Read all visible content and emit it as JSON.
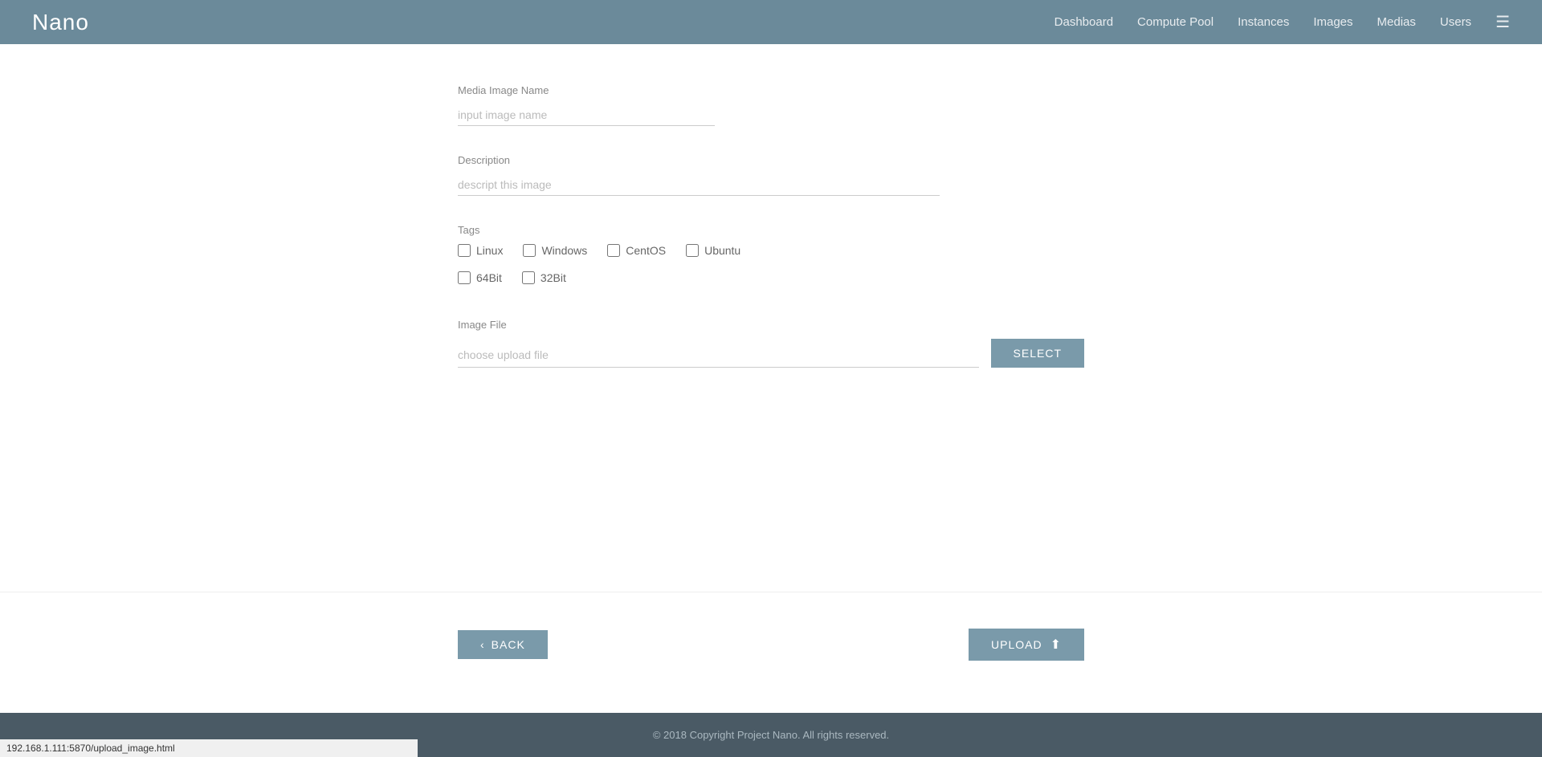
{
  "header": {
    "logo": "Nano",
    "nav": {
      "dashboard": "Dashboard",
      "compute_pool": "Compute Pool",
      "instances": "Instances",
      "images": "Images",
      "medias": "Medias",
      "users": "Users"
    }
  },
  "form": {
    "media_image_name_label": "Media Image Name",
    "media_image_name_placeholder": "input image name",
    "description_label": "Description",
    "description_placeholder": "descript this image",
    "tags_label": "Tags",
    "tags": [
      {
        "id": "linux",
        "label": "Linux"
      },
      {
        "id": "windows",
        "label": "Windows"
      },
      {
        "id": "centos",
        "label": "CentOS"
      },
      {
        "id": "ubuntu",
        "label": "Ubuntu"
      },
      {
        "id": "64bit",
        "label": "64Bit"
      },
      {
        "id": "32bit",
        "label": "32Bit"
      }
    ],
    "image_file_label": "Image File",
    "file_placeholder": "choose upload file",
    "select_btn": "SELECT"
  },
  "actions": {
    "back_label": "BACK",
    "upload_label": "UPLOAD"
  },
  "footer": {
    "copyright": "© 2018 Copyright Project Nano. All rights reserved."
  },
  "status_bar": {
    "url": "192.168.1.111:5870/upload_image.html"
  }
}
